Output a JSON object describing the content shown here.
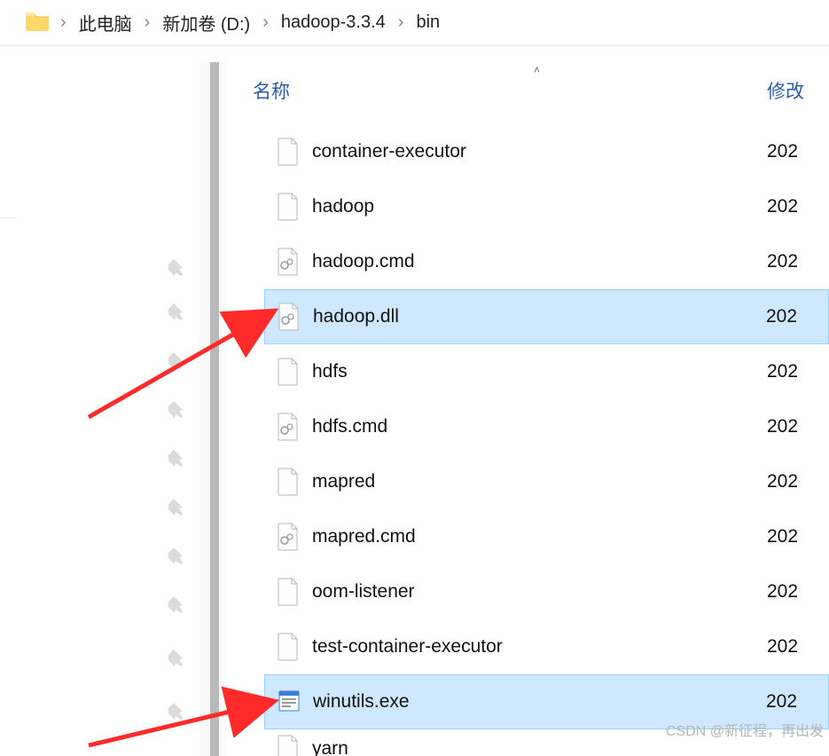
{
  "breadcrumb": {
    "items": [
      {
        "label": "此电脑"
      },
      {
        "label": "新加卷 (D:)"
      },
      {
        "label": "hadoop-3.3.4"
      },
      {
        "label": "bin"
      }
    ],
    "sep": "›"
  },
  "columns": {
    "name": "名称",
    "modified": "修改"
  },
  "files": [
    {
      "name": "container-executor",
      "type": "generic",
      "selected": false,
      "mod": "202"
    },
    {
      "name": "hadoop",
      "type": "generic",
      "selected": false,
      "mod": "202"
    },
    {
      "name": "hadoop.cmd",
      "type": "cmd",
      "selected": false,
      "mod": "202"
    },
    {
      "name": "hadoop.dll",
      "type": "cmd",
      "selected": true,
      "mod": "202"
    },
    {
      "name": "hdfs",
      "type": "generic",
      "selected": false,
      "mod": "202"
    },
    {
      "name": "hdfs.cmd",
      "type": "cmd",
      "selected": false,
      "mod": "202"
    },
    {
      "name": "mapred",
      "type": "generic",
      "selected": false,
      "mod": "202"
    },
    {
      "name": "mapred.cmd",
      "type": "cmd",
      "selected": false,
      "mod": "202"
    },
    {
      "name": "oom-listener",
      "type": "generic",
      "selected": false,
      "mod": "202"
    },
    {
      "name": "test-container-executor",
      "type": "generic",
      "selected": false,
      "mod": "202"
    },
    {
      "name": "winutils.exe",
      "type": "exe",
      "selected": true,
      "mod": "202"
    },
    {
      "name": "yarn",
      "type": "generic",
      "selected": false,
      "mod": ""
    }
  ],
  "watermark": "CSDN @新征程，再出发"
}
